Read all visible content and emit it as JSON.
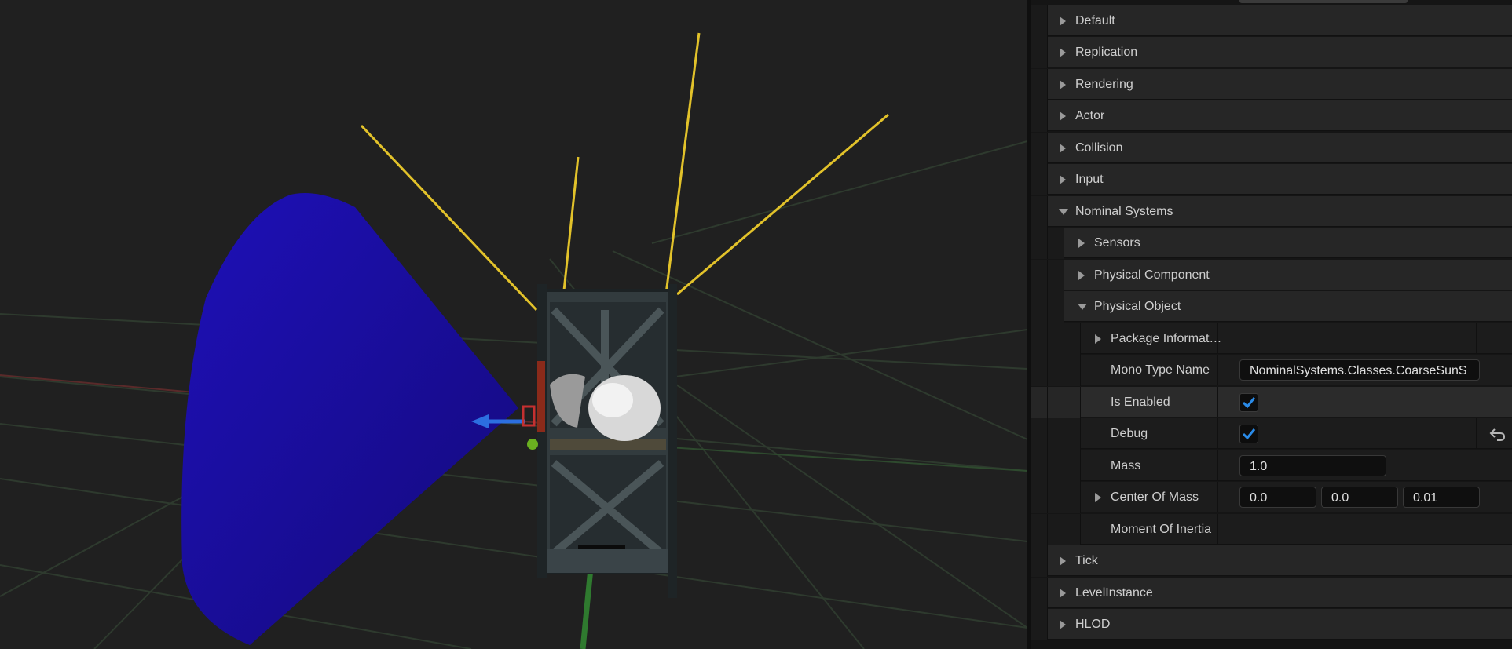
{
  "viewport": {
    "accent_colors": {
      "background": "#202020",
      "fov_cone": "#1a0aa8",
      "sensor_rays": "#e6c62a",
      "frame": "#3a4448"
    }
  },
  "details": {
    "categories_top": [
      {
        "label": "Default",
        "expanded": false
      },
      {
        "label": "Replication",
        "expanded": false
      },
      {
        "label": "Rendering",
        "expanded": false
      },
      {
        "label": "Actor",
        "expanded": false
      },
      {
        "label": "Collision",
        "expanded": false
      },
      {
        "label": "Input",
        "expanded": false
      }
    ],
    "nominal_systems": {
      "label": "Nominal Systems",
      "expanded": true,
      "sensors": {
        "label": "Sensors",
        "expanded": false
      },
      "physical_component": {
        "label": "Physical Component",
        "expanded": false
      },
      "physical_object": {
        "label": "Physical Object",
        "expanded": true,
        "package_information": {
          "label": "Package Informat…",
          "expanded": false
        },
        "mono_type_name": {
          "label": "Mono Type Name",
          "value": "NominalSystems.Classes.CoarseSunS"
        },
        "is_enabled": {
          "label": "Is Enabled",
          "checked": true
        },
        "debug": {
          "label": "Debug",
          "checked": true,
          "reset_icon": "reset-to-default-icon"
        },
        "mass": {
          "label": "Mass",
          "value": "1.0"
        },
        "center_of_mass": {
          "label": "Center Of Mass",
          "x": "0.0",
          "y": "0.0",
          "z": "0.01"
        },
        "moment_of_inertia": {
          "label": "Moment Of Inertia"
        }
      }
    },
    "categories_bottom": [
      {
        "label": "Tick",
        "expanded": false
      },
      {
        "label": "LevelInstance",
        "expanded": false
      },
      {
        "label": "HLOD",
        "expanded": false
      }
    ]
  }
}
